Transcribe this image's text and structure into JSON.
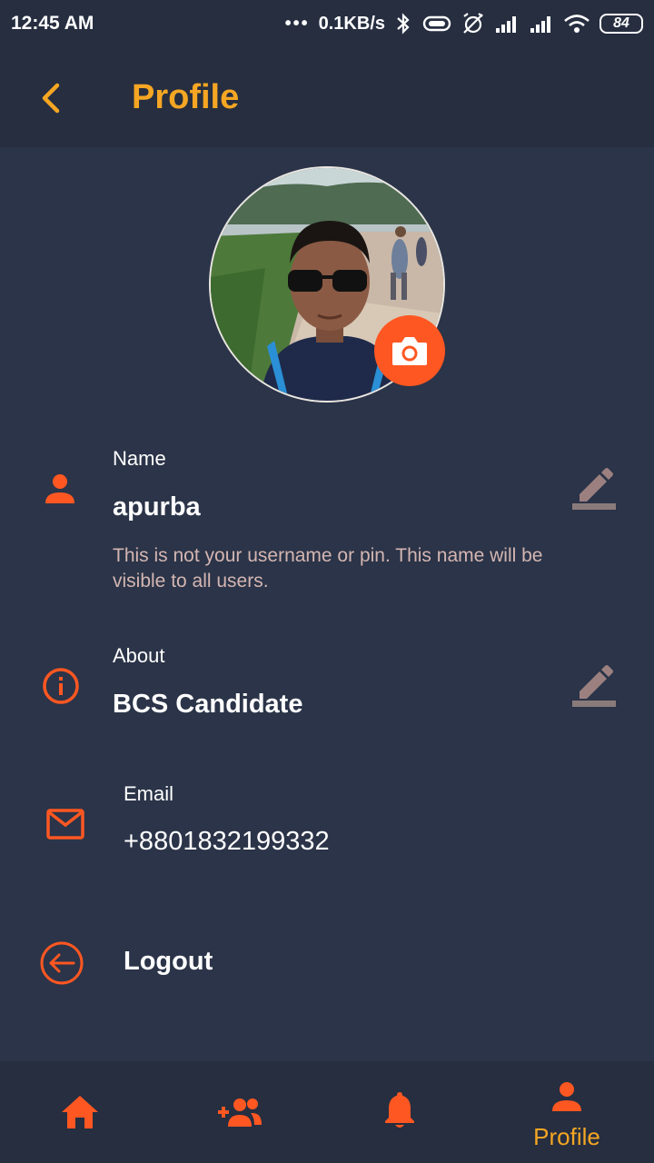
{
  "status_bar": {
    "time": "12:45 AM",
    "network_speed": "0.1KB/s",
    "battery_level": "84"
  },
  "app_bar": {
    "title": "Profile"
  },
  "profile": {
    "name_label": "Name",
    "name_value": "apurba",
    "name_help": "This is not your username or pin. This name will be visible to all users.",
    "about_label": "About",
    "about_value": "BCS Candidate",
    "email_label": "Email",
    "email_value": "+8801832199332",
    "logout_label": "Logout"
  },
  "bottom_nav": {
    "items": [
      {
        "icon": "home-icon"
      },
      {
        "icon": "add-friend-icon"
      },
      {
        "icon": "bell-icon"
      },
      {
        "icon": "person-icon",
        "label": "Profile"
      }
    ]
  },
  "colors": {
    "accent": "#f5a623",
    "icon_accent": "#ff5722",
    "background": "#2b3448",
    "bar_background": "#262e40",
    "help_text": "#d4b6b2"
  }
}
